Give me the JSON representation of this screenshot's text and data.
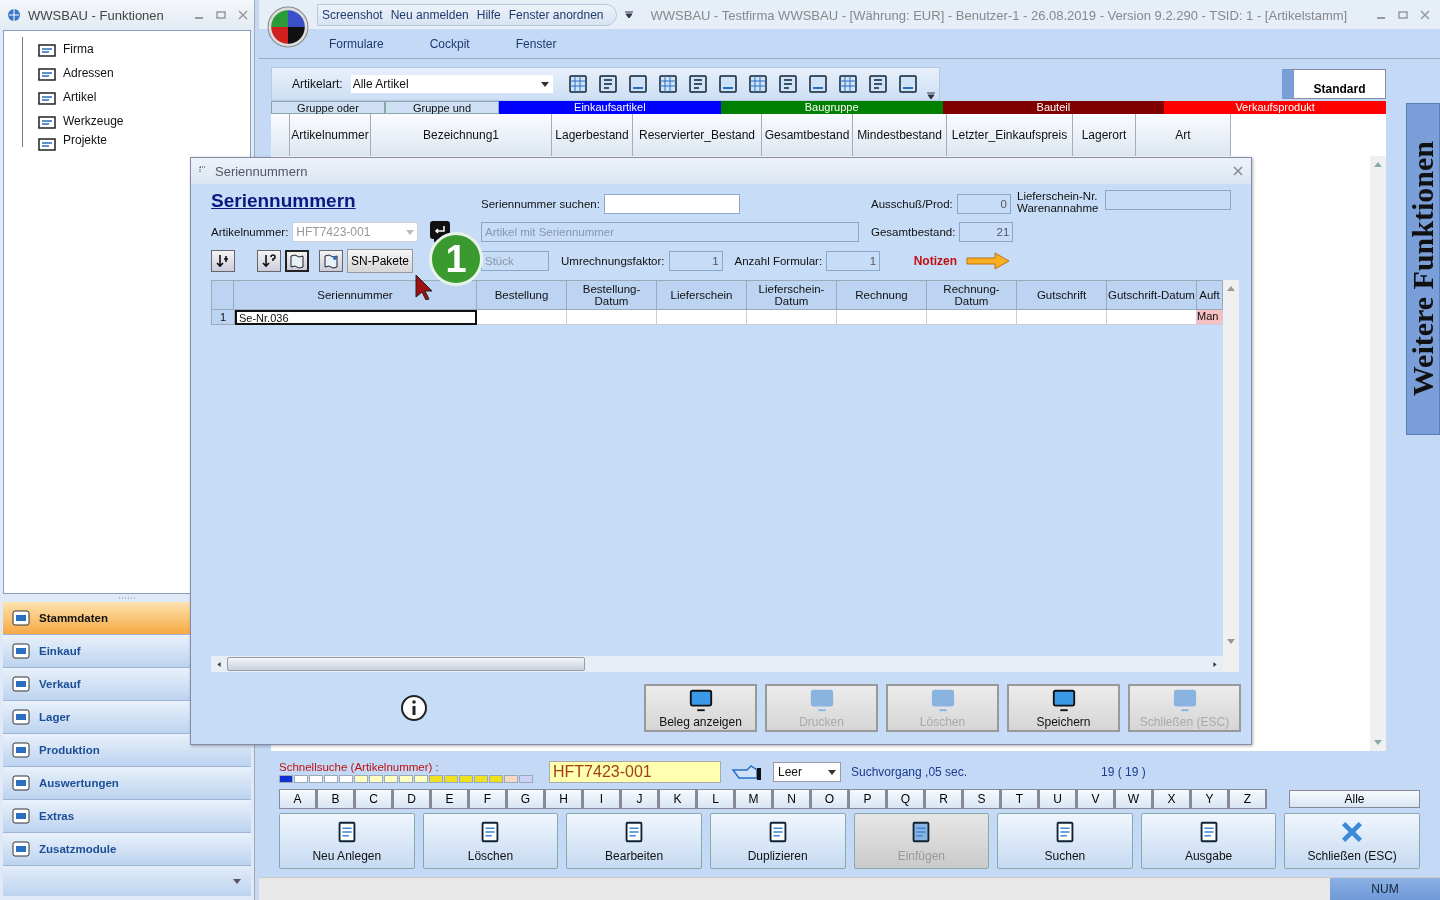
{
  "functions_window": {
    "title": "WWSBAU - Funktionen",
    "tree": [
      {
        "label": "Firma"
      },
      {
        "label": "Adressen"
      },
      {
        "label": "Artikel"
      },
      {
        "label": "Werkzeuge"
      },
      {
        "label": "Projekte"
      }
    ],
    "nav": [
      {
        "label": "Stammdaten",
        "selected": true
      },
      {
        "label": "Einkauf",
        "selected": false
      },
      {
        "label": "Verkauf",
        "selected": false
      },
      {
        "label": "Lager",
        "selected": false
      },
      {
        "label": "Produktion",
        "selected": false
      },
      {
        "label": "Auswertungen",
        "selected": false
      },
      {
        "label": "Extras",
        "selected": false
      },
      {
        "label": "Zusatzmodule",
        "selected": false
      }
    ]
  },
  "main_window": {
    "quick_access": [
      "Screenshot",
      "Neu anmelden",
      "Hilfe",
      "Fenster anordnen"
    ],
    "title": "WWSBAU - Testfirma WWSBAU - [Währung: EUR] - Benutzer-1 - 26.08.2019 - Version 9.2.290 - TSID: 1  - [Artikelstamm]",
    "menu": [
      "Formulare",
      "Cockpit",
      "Fenster"
    ],
    "toolbar": {
      "label": "Artikelart:",
      "value": "Alle Artikel"
    },
    "standard_button": "Standard",
    "groups": [
      {
        "label": "Gruppe oder",
        "kind": "button"
      },
      {
        "label": "Gruppe und",
        "kind": "button"
      },
      {
        "label": "Einkaufsartikel",
        "kind": "band",
        "color": "#0000ff"
      },
      {
        "label": "Baugruppe",
        "kind": "band",
        "color": "#008000"
      },
      {
        "label": "Bauteil",
        "kind": "band",
        "color": "#800000"
      },
      {
        "label": "Verkaufsprodukt",
        "kind": "band",
        "color": "#ff0000"
      }
    ],
    "columns": [
      "Artikelnummer",
      "Bezeichnung1",
      "Lagerbestand",
      "Reservierter_Bestand",
      "Gesamtbestand",
      "Mindestbestand",
      "Letzter_Einkaufspreis",
      "Lagerort",
      "Art"
    ],
    "side_tab": "Weitere Funktionen",
    "quick_search": {
      "label": "Schnellsuche (Artikelnummer) :",
      "value": "HFT7423-001",
      "filter": "Leer",
      "status": "Suchvorgang ,05 sec.",
      "count": "19  ( 19 )"
    },
    "letters": [
      "A",
      "B",
      "C",
      "D",
      "E",
      "F",
      "G",
      "H",
      "I",
      "J",
      "K",
      "L",
      "M",
      "N",
      "O",
      "P",
      "Q",
      "R",
      "S",
      "T",
      "U",
      "V",
      "W",
      "X",
      "Y",
      "Z"
    ],
    "all_button": "Alle",
    "actions": [
      {
        "label": "Neu Anlegen",
        "disabled": false
      },
      {
        "label": "Löschen",
        "disabled": false
      },
      {
        "label": "Bearbeiten",
        "disabled": false
      },
      {
        "label": "Duplizieren",
        "disabled": false
      },
      {
        "label": "Einfügen",
        "disabled": true
      },
      {
        "label": "Suchen",
        "disabled": false
      },
      {
        "label": "Ausgabe",
        "disabled": false
      },
      {
        "label": "Schließen (ESC)",
        "disabled": false
      }
    ],
    "status_bar": {
      "num": "NUM"
    }
  },
  "dialog": {
    "title": "Seriennummern",
    "heading": "Seriennummern",
    "search_label": "Seriennummer suchen:",
    "article_label": "Artikelnummer:",
    "article_value": "HFT7423-001",
    "article_name": "Artikel mit Seriennummer",
    "unit": "Stück",
    "conversion_label": "Umrechnungsfaktor:",
    "conversion_value": "1",
    "forms_label": "Anzahl Formular:",
    "forms_value": "1",
    "scrap_label": "Ausschuß/Prod:",
    "scrap_value": "0",
    "total_label": "Gesamtbestand:",
    "total_value": "21",
    "delivery_label": "Lieferschein-Nr. Warenannahme",
    "notes": "Notizen",
    "sn_button": "SN-Pakete",
    "badge": "1",
    "columns": [
      "Seriennummer",
      "Bestellung",
      "Bestellung-Datum",
      "Lieferschein",
      "Lieferschein-Datum",
      "Rechnung",
      "Rechnung-Datum",
      "Gutschrift",
      "Gutschrift-Datum",
      "Auft"
    ],
    "rows": [
      {
        "number": "1",
        "serial": "Se-Nr.036",
        "last": "Man"
      }
    ],
    "buttons": [
      {
        "label": "Beleg anzeigen",
        "disabled": false
      },
      {
        "label": "Drucken",
        "disabled": true
      },
      {
        "label": "Löschen",
        "disabled": true
      },
      {
        "label": "Speichern",
        "disabled": false
      },
      {
        "label": "Schließen (ESC)",
        "disabled": true
      }
    ]
  }
}
